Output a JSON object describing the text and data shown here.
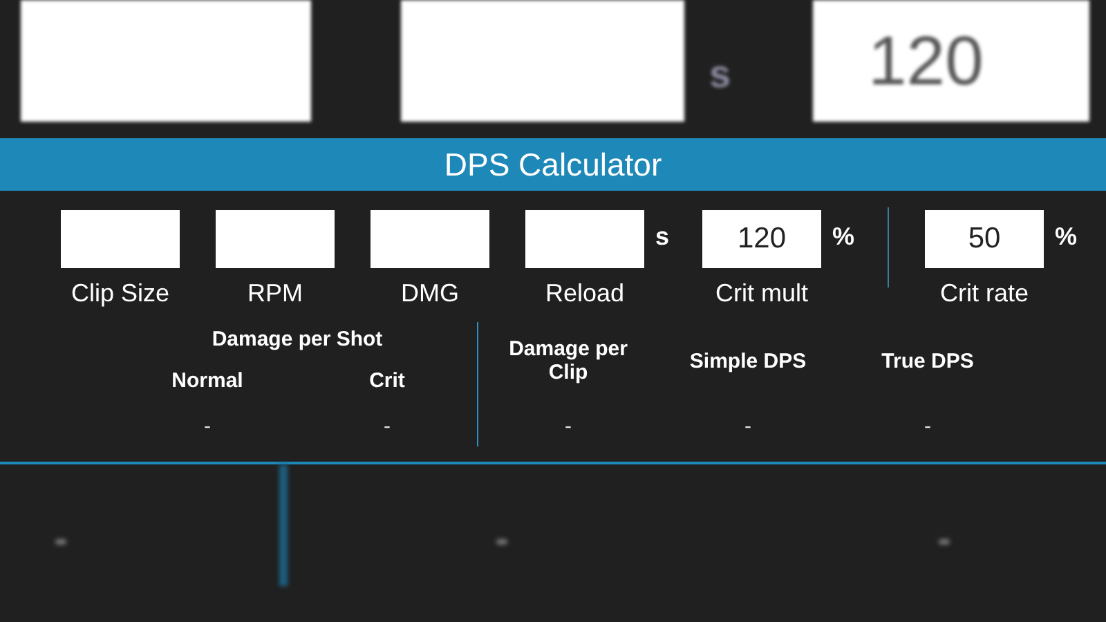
{
  "backdrop_top": {
    "unit": "s",
    "value": "120"
  },
  "title": "DPS Calculator",
  "inputs": [
    {
      "label": "Clip Size"
    },
    {
      "label": "RPM"
    },
    {
      "label": "DMG"
    },
    {
      "label": "Reload",
      "unit": "s"
    },
    {
      "label": "Crit mult",
      "value": "120",
      "unit": "%"
    },
    {
      "label": "Crit rate",
      "value": "50",
      "unit": "%",
      "separated": true
    }
  ],
  "damage_per_shot": {
    "title": "Damage per Shot",
    "columns": [
      {
        "label": "Normal",
        "value": "-"
      },
      {
        "label": "Crit",
        "value": "-"
      }
    ]
  },
  "results": [
    {
      "label": "Damage per Clip",
      "value": "-"
    },
    {
      "label": "Simple DPS",
      "value": "-"
    },
    {
      "label": "True DPS",
      "value": "-"
    }
  ]
}
